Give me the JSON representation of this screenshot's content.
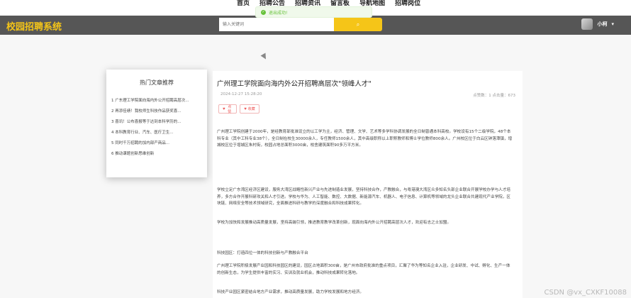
{
  "nav": {
    "items": [
      "首页",
      "招聘公告",
      "招聘资讯",
      "留言板",
      "导航地图",
      "招聘岗位"
    ]
  },
  "toast": {
    "message": "退出成功!"
  },
  "header": {
    "logo": "校园招聘系统",
    "search_placeholder": "输入关键词",
    "search_button": "⌕",
    "username": "小柯",
    "caret": "▾"
  },
  "sidebar": {
    "title": "热门文章推荐",
    "items": [
      "1  广东理工学院面向海内外公开招聘高层次...",
      "2  再添佳绩！我校师生科技作品获奖喜...",
      "3  喜讯！公布喜报等于达到本科学历的...",
      "4  本科教育行业、汽车、医疗卫生...",
      "5  同时千万招聘的加内部产商品...",
      "6  推动课题创新思维创新"
    ]
  },
  "article": {
    "title": "广州理工学院面向海内外公开招聘高层次\"领峰人才\"",
    "date": "2024-12-27 15:28:20",
    "stats": "点赞数：1    点击量：673",
    "like_label": "点赞",
    "fav_label": "收藏",
    "paragraphs": [
      "广州理工学院创建于2000年，是经教育部批准设立的以工学为主，经济、管理、文学、艺术等多学科协调发展的全日制普通本科高校。学校设有15个二级学院，48个本科专业（其中工科专业38个），全日制在校生30000余人，专任教师1500余人，其中高级职称以上职称教师和博士学位教师800余人。广州校区位于白云区钟落潭镇，增城校区位于增城区朱村街，校园占地总面积3000亩，校舍建筑面积90多万平方米。",
      "学校立足广东湾区经济区建设，服务大湾区战略性新兴产业与先进制造业发展，坚持科技合作，产教融合，与粤港澳大湾区众多知名头部企业联合开展学校办学与人才培养，多方合作开展科研攻关和人才引进。学校与华为、人工智能、数控、大数据、新能源汽车、机器人、电子信息、计算机等领域的龙头企业联合共建现代产业学院，区块链、网络安全等技术领域研究，全面推进科研与教学的深度融合和科技成果转化。",
      "学校为加快和发展推动高质量发展，坚持高端引领，推进教育教学改革创新，现面向海内外公开招聘高层次人才，欢迎有志之士加盟。",
      "科技园区：打造四位一体的科技创新与产教融合平台",
      "广州理工学院积极发展产业园和科技园区的建设，园区占地面积300亩，是广州市政府批准的重点项目，汇聚了华为等知名企业入驻，企业研发、中试、孵化、生产一体的创新生态，为学生提供丰富的实习、实训及就业机会，推动科技成果转化落地。",
      "科技产业园区紧密结合地方产业需求，推动高质量发展，助力学校发展和地方经济。"
    ]
  },
  "watermark": "CSDN @vx_CXKF10088",
  "colors": {
    "header_bg": "#565656",
    "accent": "#f5c518",
    "toast_green": "#67c23a",
    "button_red": "#e55555"
  }
}
